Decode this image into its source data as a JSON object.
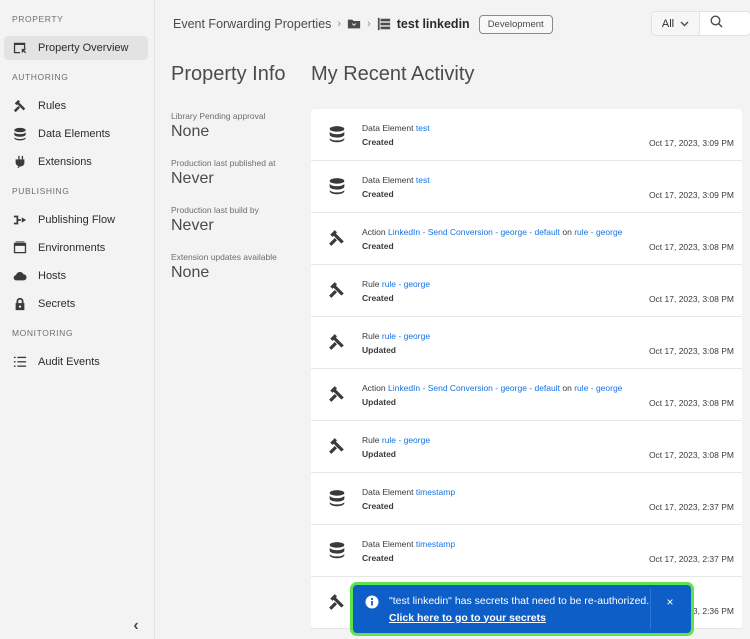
{
  "sidebar": {
    "sections": [
      {
        "label": "PROPERTY"
      },
      {
        "label": "AUTHORING"
      },
      {
        "label": "PUBLISHING"
      },
      {
        "label": "MONITORING"
      }
    ],
    "items": [
      {
        "label": "Property Overview",
        "icon": "property-overview-icon",
        "active": true
      },
      {
        "label": "Rules",
        "icon": "rules-icon"
      },
      {
        "label": "Data Elements",
        "icon": "data-elements-icon"
      },
      {
        "label": "Extensions",
        "icon": "extensions-icon"
      },
      {
        "label": "Publishing Flow",
        "icon": "publishing-flow-icon"
      },
      {
        "label": "Environments",
        "icon": "environments-icon"
      },
      {
        "label": "Hosts",
        "icon": "hosts-icon"
      },
      {
        "label": "Secrets",
        "icon": "secrets-icon"
      },
      {
        "label": "Audit Events",
        "icon": "audit-events-icon"
      }
    ],
    "collapse_glyph": "‹"
  },
  "header": {
    "breadcrumb_root": "Event Forwarding Properties",
    "separator": "›",
    "property_name": "test linkedin",
    "environment_badge": "Development",
    "search_scope": "All",
    "search_placeholder": ""
  },
  "property_info": {
    "title": "Property Info",
    "fields": [
      {
        "label": "Library Pending approval",
        "value": "None"
      },
      {
        "label": "Production last published at",
        "value": "Never"
      },
      {
        "label": "Production last build by",
        "value": "Never"
      },
      {
        "label": "Extension updates available",
        "value": "None"
      }
    ]
  },
  "recent_activity": {
    "title": "My Recent Activity",
    "items": [
      {
        "icon": "data-element",
        "type": "Data Element",
        "name": "test",
        "on": null,
        "target": null,
        "status": "Created",
        "time": "Oct 17, 2023, 3:09 PM"
      },
      {
        "icon": "data-element",
        "type": "Data Element",
        "name": "test",
        "on": null,
        "target": null,
        "status": "Created",
        "time": "Oct 17, 2023, 3:09 PM"
      },
      {
        "icon": "rule",
        "type": "Action",
        "name": "LinkedIn - Send Conversion - george - default",
        "on": "on",
        "target": "rule - george",
        "status": "Created",
        "time": "Oct 17, 2023, 3:08 PM"
      },
      {
        "icon": "rule",
        "type": "Rule",
        "name": "rule - george",
        "on": null,
        "target": null,
        "status": "Created",
        "time": "Oct 17, 2023, 3:08 PM"
      },
      {
        "icon": "rule",
        "type": "Rule",
        "name": "rule - george",
        "on": null,
        "target": null,
        "status": "Updated",
        "time": "Oct 17, 2023, 3:08 PM"
      },
      {
        "icon": "rule",
        "type": "Action",
        "name": "LinkedIn - Send Conversion - george - default",
        "on": "on",
        "target": "rule - george",
        "status": "Updated",
        "time": "Oct 17, 2023, 3:08 PM"
      },
      {
        "icon": "rule",
        "type": "Rule",
        "name": "rule - george",
        "on": null,
        "target": null,
        "status": "Updated",
        "time": "Oct 17, 2023, 3:08 PM"
      },
      {
        "icon": "data-element",
        "type": "Data Element",
        "name": "timestamp",
        "on": null,
        "target": null,
        "status": "Created",
        "time": "Oct 17, 2023, 2:37 PM"
      },
      {
        "icon": "data-element",
        "type": "Data Element",
        "name": "timestamp",
        "on": null,
        "target": null,
        "status": "Created",
        "time": "Oct 17, 2023, 2:37 PM"
      },
      {
        "icon": "rule",
        "type": "",
        "name": "",
        "on": null,
        "target": null,
        "status": "",
        "time": "3, 2:36 PM"
      }
    ]
  },
  "toast": {
    "message": "\"test linkedin\" has secrets that need to be re-authorized.",
    "link": "Click here to go to your secrets",
    "close": "×",
    "colors": {
      "background": "#0d5fc7",
      "focus_ring": "#5ee34a"
    }
  },
  "colors": {
    "link": "#1473e6",
    "sidebar_bg": "#f3f3f3",
    "active_item": "#e3e3e3"
  }
}
